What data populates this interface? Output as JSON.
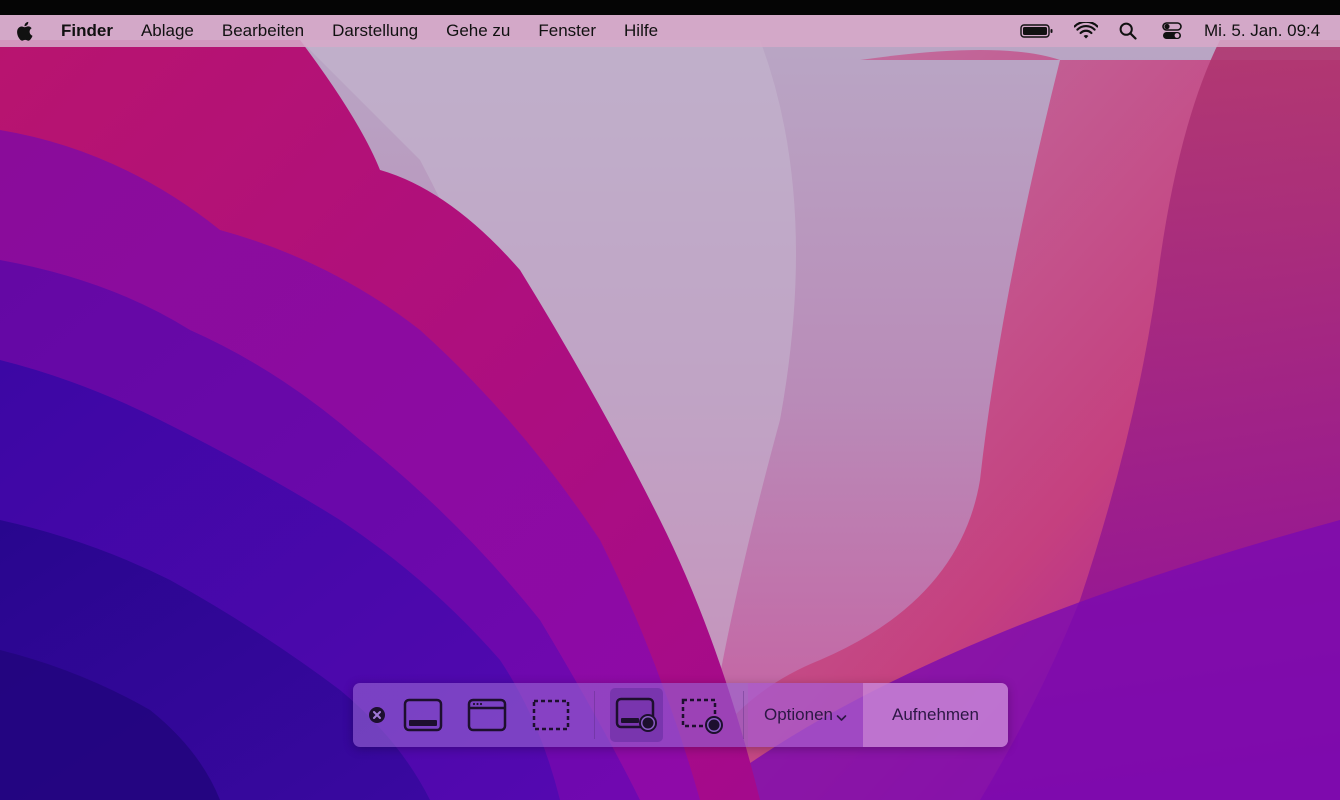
{
  "menubar": {
    "apple_icon": "apple-logo-icon",
    "app_name": "Finder",
    "items": [
      "Ablage",
      "Bearbeiten",
      "Darstellung",
      "Gehe zu",
      "Fenster",
      "Hilfe"
    ],
    "status_icons": [
      "battery-icon",
      "wifi-icon",
      "search-icon",
      "control-center-icon"
    ],
    "clock": "Mi. 5. Jan.  09:4"
  },
  "screenshot_toolbar": {
    "close_icon": "close-icon",
    "tools": [
      {
        "name": "capture-entire-screen",
        "icon": "screen-icon",
        "selected": false
      },
      {
        "name": "capture-selected-window",
        "icon": "window-icon",
        "selected": false
      },
      {
        "name": "capture-selected-portion",
        "icon": "dashed-selection-icon",
        "selected": false
      },
      {
        "name": "record-entire-screen",
        "icon": "record-screen-icon",
        "selected": true
      },
      {
        "name": "record-selected-portion",
        "icon": "record-selection-icon",
        "selected": false
      }
    ],
    "options_label": "Optionen",
    "options_icon": "chevron-down-icon",
    "capture_label": "Aufnehmen"
  },
  "colors": {
    "menubar_bg": "#d6a8c8",
    "toolbar_bg": "#9664d2",
    "capture_bg": "#d78cd7",
    "wallpaper_blue": "#3a0aa6",
    "wallpaper_magenta": "#b0137e"
  }
}
